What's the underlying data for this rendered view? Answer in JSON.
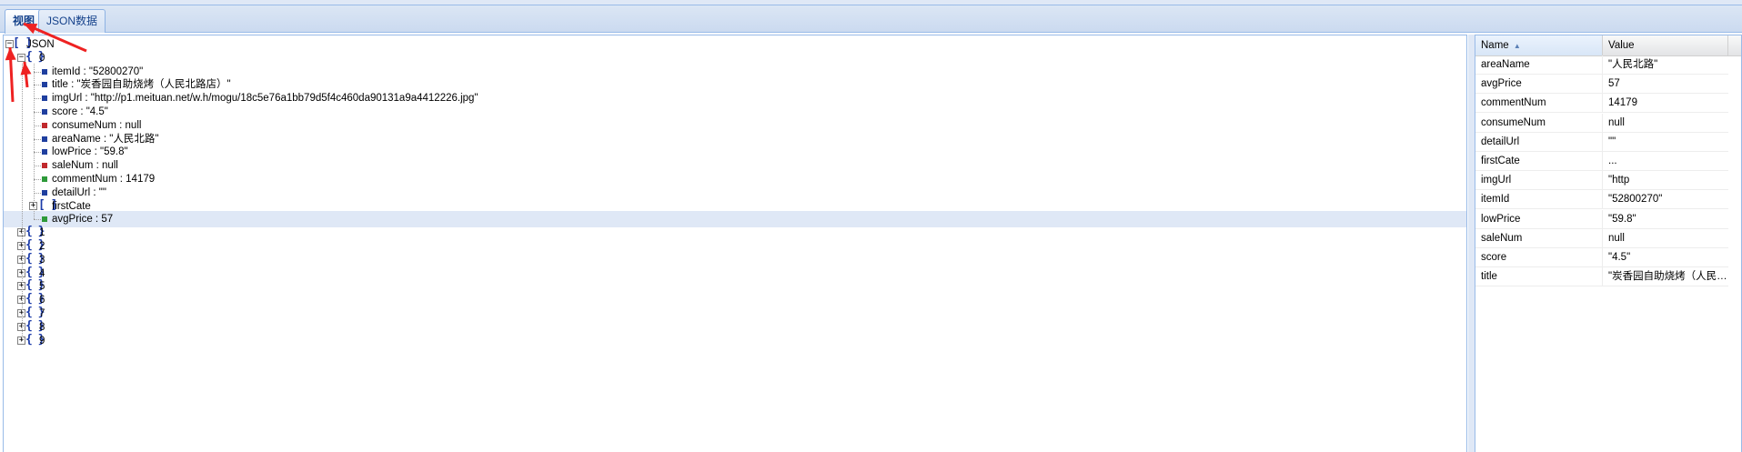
{
  "tabs": [
    {
      "label": "视图",
      "active": true
    },
    {
      "label": "JSON数据",
      "active": false
    }
  ],
  "tree": {
    "root_label": "JSON",
    "node0": {
      "label": "0",
      "fields": [
        {
          "text": "itemId : \"52800270\"",
          "type": "string"
        },
        {
          "text": "title : \"炭香园自助烧烤（人民北路店）\"",
          "type": "string"
        },
        {
          "text": "imgUrl : \"http://p1.meituan.net/w.h/mogu/18c5e76a1bb79d5f4c460da90131a9a4412226.jpg\"",
          "type": "string"
        },
        {
          "text": "score : \"4.5\"",
          "type": "string"
        },
        {
          "text": "consumeNum : null",
          "type": "null"
        },
        {
          "text": "areaName : \"人民北路\"",
          "type": "string"
        },
        {
          "text": "lowPrice : \"59.8\"",
          "type": "string"
        },
        {
          "text": "saleNum : null",
          "type": "null"
        },
        {
          "text": "commentNum : 14179",
          "type": "number"
        },
        {
          "text": "detailUrl : \"\"",
          "type": "string"
        }
      ],
      "array_child": "firstCate",
      "last_field": {
        "text": "avgPrice : 57",
        "type": "number"
      }
    },
    "collapsed_nodes": [
      "1",
      "2",
      "3",
      "4",
      "5",
      "6",
      "7",
      "8",
      "9"
    ]
  },
  "grid": {
    "headers": {
      "name": "Name",
      "value": "Value"
    },
    "rows": [
      {
        "name": "areaName",
        "value": "\"人民北路\""
      },
      {
        "name": "avgPrice",
        "value": "57"
      },
      {
        "name": "commentNum",
        "value": "14179"
      },
      {
        "name": "consumeNum",
        "value": "null"
      },
      {
        "name": "detailUrl",
        "value": "\"\""
      },
      {
        "name": "firstCate",
        "value": "..."
      },
      {
        "name": "imgUrl",
        "value": "\"http"
      },
      {
        "name": "itemId",
        "value": "\"52800270\""
      },
      {
        "name": "lowPrice",
        "value": "\"59.8\""
      },
      {
        "name": "saleNum",
        "value": "null"
      },
      {
        "name": "score",
        "value": "\"4.5\""
      },
      {
        "name": "title",
        "value": "\"炭香园自助烧烤（人民北路店）\""
      }
    ]
  },
  "colors": {
    "string": "#1f3f9f",
    "null": "#c0282c",
    "number": "#2e9a3a",
    "annotation_arrow": "#ee2222"
  },
  "icons": {
    "expand": "plus-box-icon",
    "collapse": "minus-box-icon",
    "array": "square-brackets-icon",
    "object": "curly-braces-icon",
    "sort": "sort-ascending-icon"
  }
}
